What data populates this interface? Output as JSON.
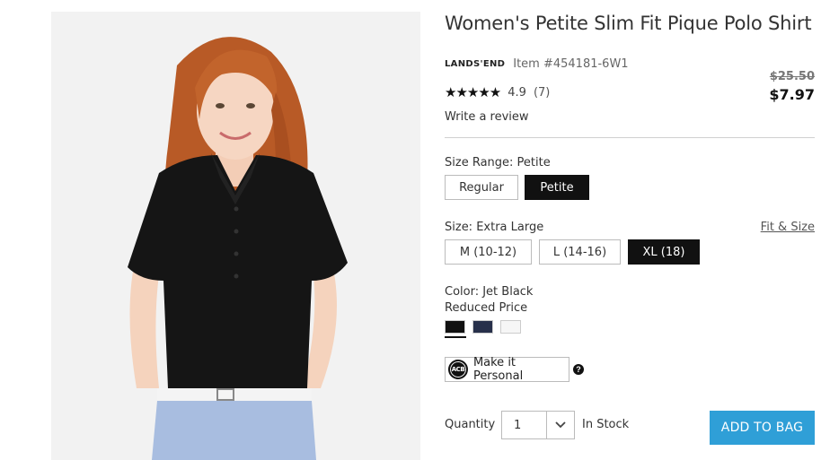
{
  "product": {
    "title": "Women's Petite Slim Fit Pique Polo Shirt",
    "brand": "LANDS'END",
    "item_number": "Item #454181-6W1",
    "original_price": "$25.50",
    "sale_price": "$7.97",
    "rating": {
      "stars": "★★★★★",
      "value": "4.9",
      "count": "(7)",
      "filled_stars": 5
    },
    "write_review": "Write a review"
  },
  "size_range": {
    "label": "Size Range: Petite",
    "options": [
      "Regular",
      "Petite"
    ],
    "selected": "Petite"
  },
  "size": {
    "label": "Size: Extra Large",
    "fit_link": "Fit & Size",
    "options": [
      "M (10-12)",
      "L (14-16)",
      "XL (18)"
    ],
    "selected": "XL (18)"
  },
  "color": {
    "label": "Color: Jet Black",
    "sublabel": "Reduced Price",
    "swatches": [
      {
        "name": "Jet Black",
        "hex": "#111111",
        "selected": true
      },
      {
        "name": "Navy",
        "hex": "#27304a",
        "selected": false
      },
      {
        "name": "White",
        "hex": "#f6f6f6",
        "selected": false
      }
    ]
  },
  "personalize": {
    "icon_text": "ACB",
    "label": "Make it Personal",
    "help_icon": "?"
  },
  "purchase": {
    "quantity_label": "Quantity",
    "quantity_value": "1",
    "stock_status": "In Stock",
    "add_to_bag": "ADD TO BAG",
    "accent_color": "#2f9fd7"
  }
}
